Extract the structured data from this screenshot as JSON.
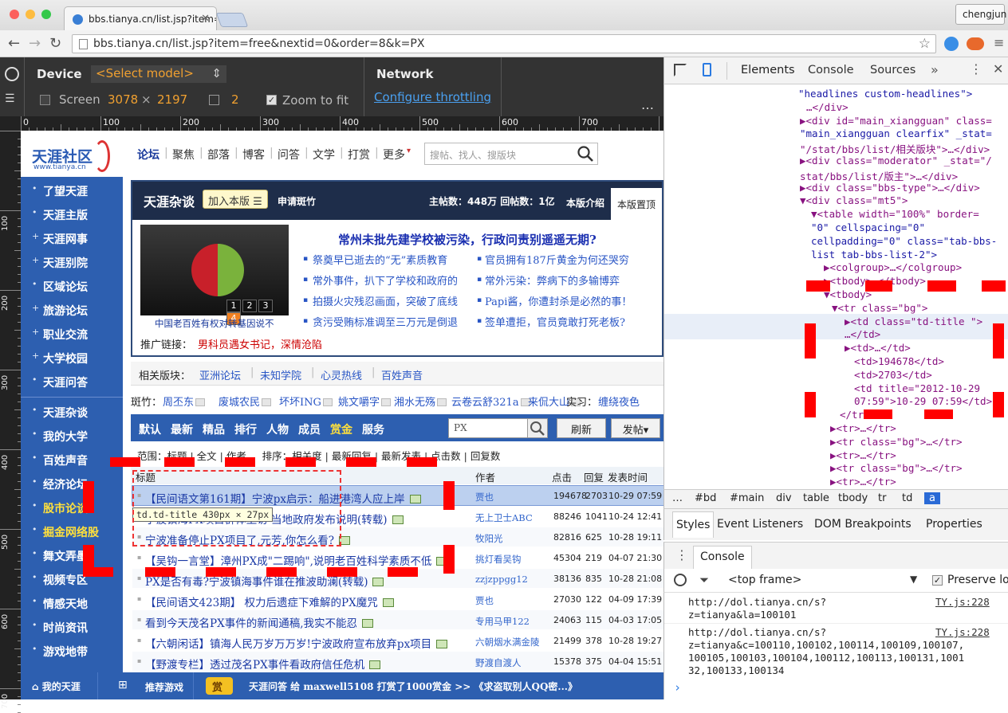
{
  "browser": {
    "tab_title": "bbs.tianya.cn/list.jsp?item=",
    "url": "bbs.tianya.cn/list.jsp?item=free&nextid=0&order=8&k=PX",
    "profile": "chengjun"
  },
  "device_mode": {
    "device_label": "Device",
    "model": "<Select model>",
    "screen_label": "Screen",
    "screen_w": "3078",
    "screen_x": "×",
    "screen_h": "2197",
    "dpr": "2",
    "zoom_label": "Zoom to fit",
    "network_label": "Network",
    "throttle_label": "Configure throttling"
  },
  "ruler": {
    "h": [
      "0",
      "100",
      "200",
      "300",
      "400",
      "500",
      "600",
      "700"
    ],
    "v": [
      "100",
      "200",
      "300",
      "400",
      "500",
      "600",
      "700"
    ]
  },
  "site": {
    "logo": "天涯社区",
    "logo_url": "www.tianya.cn",
    "nav": [
      "论坛",
      "聚焦",
      "部落",
      "博客",
      "问答",
      "文学",
      "打赏",
      "更多"
    ],
    "search_placeholder": "搜帖、找人、搜版块",
    "sidebar": [
      "了望天涯",
      "天涯主版",
      "天涯网事",
      "天涯别院",
      "区域论坛",
      "旅游论坛",
      "职业交流",
      "大学校园",
      "天涯问答",
      "天涯杂谈",
      "我的大学",
      "百姓声音",
      "经济论坛",
      "股市论谈",
      "掘金网络股",
      "舞文弄墨",
      "视频专区",
      "情感天地",
      "时尚资讯",
      "游戏地带"
    ],
    "board": {
      "name": "天涯杂谈",
      "join": "加入本版 ☰",
      "apply": "申请斑竹",
      "stats": "主帖数：448万 回帖数：1亿",
      "intro": "本版介绍",
      "top": "本版置顶",
      "headline": "常州未批先建学校被污染，行政问责别遥遥无期?",
      "img_caption": "中国老百姓有权对转基因说不",
      "img_pages": [
        "1",
        "2",
        "3",
        "4"
      ],
      "left_links": [
        "祭奠早已逝去的“无”素质教育",
        "常外事件，扒下了学校和政府的",
        "拍摄火灾残忍画面，突破了底线",
        "贪污受贿标准调至三万元是倒退"
      ],
      "right_links": [
        "官员拥有187斤黄金为何还哭穷",
        "常外污染：弊病下的多输博弈",
        "Papi酱，你遭封杀是必然的事！",
        "签单遭拒，官员竟敢打死老板?"
      ],
      "promo_label": "推广链接：",
      "promo": "男科员遇女书记，深情沧陷"
    },
    "related_label": "相关版块：",
    "related": [
      "亚洲论坛",
      "未知学院",
      "心灵热线",
      "百姓声音"
    ],
    "moderators_label": "斑竹：",
    "moderators": [
      "周丕东",
      "废城农民",
      "坏坏ING",
      "姚文嚼字",
      "湘水无殇",
      "云卷云舒321a",
      "来侃大山"
    ],
    "intern_label": "实习：",
    "intern": "缠绕夜色",
    "tabs": [
      "默认",
      "最新",
      "精品",
      "排行",
      "人物",
      "成员",
      "赏金",
      "服务"
    ],
    "search_value": "PX",
    "refresh": "刷新",
    "post": "发帖▾",
    "filter": "范围：标题 | 全文 | 作者     排序：相关度 | 最新回复 | 最新发表 | 点击数 | 回复数",
    "columns": [
      "标题",
      "作者",
      "点击",
      "回复",
      "发表时间"
    ],
    "rows": [
      {
        "title": "【民间语文第161期】宁波px启示：船进港湾人应上岸",
        "author": "贾也",
        "clicks": "194678",
        "replies": "2703",
        "date": "10-29 07:59"
      },
      {
        "title": "宁波镇海PX项目群体上访 当地政府发布说明(转载)",
        "author": "无上卫士ABC",
        "clicks": "88246",
        "replies": "1041",
        "date": "10-24 12:41"
      },
      {
        "title": "宁波准备停止PX项目了,元芳,你怎么看?",
        "author": "牧阳光",
        "clicks": "82816",
        "replies": "625",
        "date": "10-28 19:11"
      },
      {
        "title": "【吴钩一言堂】漳州PX成\"二踢响\",说明老百姓科学素质不低",
        "author": "挑灯看吴钩",
        "clicks": "45304",
        "replies": "219",
        "date": "04-07 21:30"
      },
      {
        "title": "PX是否有毒?宁波镇海事件谁在推波助澜(转载)",
        "author": "zzjzppgg12",
        "clicks": "38136",
        "replies": "835",
        "date": "10-28 21:08"
      },
      {
        "title": "【民间语文423期】 权力后遗症下难解的PX魔咒",
        "author": "贾也",
        "clicks": "27030",
        "replies": "122",
        "date": "04-09 17:39"
      },
      {
        "title": "看到今天茂名PX事件的新闻通稿,我实不能忍",
        "author": "专用马甲122",
        "clicks": "24063",
        "replies": "115",
        "date": "04-03 17:05"
      },
      {
        "title": "【六朝闲话】镇海人民万岁万万岁!宁波政府宣布放弃px项目",
        "author": "六朝烟水满金陵",
        "clicks": "21499",
        "replies": "378",
        "date": "10-28 19:27"
      },
      {
        "title": "【野渡专栏】透过茂名PX事件看政府信任危机",
        "author": "野渡自渡人",
        "clicks": "15378",
        "replies": "375",
        "date": "04-04 15:51"
      }
    ],
    "tooltip": "td.td-title 430px × 27px",
    "footer": {
      "my": "我的天涯",
      "games": "推荐游戏",
      "reward": "赏",
      "ticker": "天涯问答 给 maxwell5108 打赏了1000赏金 >> 《求盗取别人QQ密...》"
    }
  },
  "devtools": {
    "tabs": [
      "Elements",
      "Console",
      "Sources"
    ],
    "tree": [
      "\"headlines custom-headlines\">",
      "…</div>",
      "▶<div id=\"main_xiangguan\" class=",
      "\"main_xiangguan clearfix\" _stat=",
      "\"/stat/bbs/list/相关版块\">…</div>",
      "▶<div class=\"moderator\" _stat=\"/",
      "stat/bbs/list/版主\">…</div>",
      "▶<div class=\"bbs-type\">…</div>",
      "▼<div class=\"mt5\">",
      "▼<table width=\"100%\" border=",
      "\"0\" cellspacing=\"0\"",
      "cellpadding=\"0\" class=\"tab-bbs-",
      "list tab-bbs-list-2\">",
      "▶<colgroup>…</colgroup>",
      "▶<tbody>…</tbody>",
      "▼<tbody>",
      "▼<tr class=\"bg\">",
      "▶<td class=\"td-title \">",
      "…</td>",
      "▶<td>…</td>",
      "<td>194678</td>",
      "<td>2703</td>",
      "<td title=\"2012-10-29",
      "07:59\">10-29 07:59</td>",
      "</tr>",
      "▶<tr>…</tr>",
      "▶<tr class=\"bg\">…</tr>",
      "▶<tr>…</tr>",
      "▶<tr class=\"bg\">…</tr>",
      "▶<tr>…</tr>"
    ],
    "crumbs": [
      "…",
      "#bd",
      "#main",
      "div",
      "table",
      "tbody",
      "tr",
      "td",
      "a"
    ],
    "subtabs": [
      "Styles",
      "Event Listeners",
      "DOM Breakpoints",
      "Properties"
    ],
    "console_title": "Console",
    "frame": "<top frame>",
    "preserve": "Preserve lo",
    "log": [
      {
        "text": "http://dol.tianya.cn/s?\nz=tianya&la=100101",
        "src": "TY.js:228"
      },
      {
        "text": "http://dol.tianya.cn/s?\nz=tianya&c=100110,100102,100114,100109,100107,\n100105,100103,100104,100112,100113,100131,1001\n32,100133,100134",
        "src": "TY.js:228"
      }
    ],
    "prompt": "›"
  }
}
